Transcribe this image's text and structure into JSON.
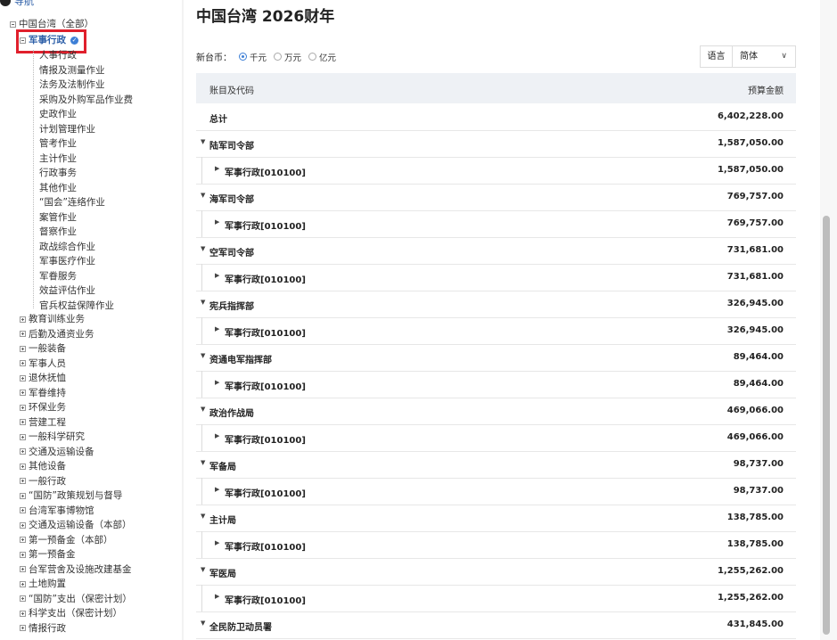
{
  "nav": {
    "title": "导航",
    "root": "中国台湾（全部）",
    "selected": "军事行政",
    "children": [
      "人事行政",
      "情报及测量作业",
      "法务及法制作业",
      "采购及外购军品作业费",
      "史政作业",
      "计划管理作业",
      "管考作业",
      "主计作业",
      "行政事务",
      "其他作业",
      "“国会”连络作业",
      "案管作业",
      "督察作业",
      "政战综合作业",
      "军事医疗作业",
      "军眷服务",
      "效益评估作业",
      "官兵权益保障作业"
    ],
    "siblings": [
      "教育训练业务",
      "后勤及通资业务",
      "一般装备",
      "军事人员",
      "退休抚恤",
      "军眷维持",
      "环保业务",
      "营建工程",
      "一般科学研究",
      "交通及运输设备",
      "其他设备",
      "一般行政",
      "“国防”政策规划与督导",
      "台湾军事博物馆",
      "交通及运输设备（本部）",
      "第一预备金（本部）",
      "第一预备金",
      "台军营舍及设施改建基金",
      "土地购置",
      "“国防”支出（保密计划）",
      "科学支出（保密计划）",
      "情报行政"
    ]
  },
  "page": {
    "title": "中国台湾 2026财年",
    "currency_label": "新台币：",
    "units": [
      {
        "label": "千元",
        "selected": true
      },
      {
        "label": "万元",
        "selected": false
      },
      {
        "label": "亿元",
        "selected": false
      }
    ],
    "language_label": "语言",
    "language_value": "简体"
  },
  "table": {
    "col_name": "账目及代码",
    "col_amount": "预算金额",
    "total_label": "总计",
    "total_amount": "6,402,228.00",
    "groups": [
      {
        "name": "陆军司令部",
        "amount": "1,587,050.00",
        "child": "军事行政[010100]",
        "child_amount": "1,587,050.00"
      },
      {
        "name": "海军司令部",
        "amount": "769,757.00",
        "child": "军事行政[010100]",
        "child_amount": "769,757.00"
      },
      {
        "name": "空军司令部",
        "amount": "731,681.00",
        "child": "军事行政[010100]",
        "child_amount": "731,681.00"
      },
      {
        "name": "宪兵指挥部",
        "amount": "326,945.00",
        "child": "军事行政[010100]",
        "child_amount": "326,945.00"
      },
      {
        "name": "资通电军指挥部",
        "amount": "89,464.00",
        "child": "军事行政[010100]",
        "child_amount": "89,464.00"
      },
      {
        "name": "政治作战局",
        "amount": "469,066.00",
        "child": "军事行政[010100]",
        "child_amount": "469,066.00"
      },
      {
        "name": "军备局",
        "amount": "98,737.00",
        "child": "军事行政[010100]",
        "child_amount": "98,737.00"
      },
      {
        "name": "主计局",
        "amount": "138,785.00",
        "child": "军事行政[010100]",
        "child_amount": "138,785.00"
      },
      {
        "name": "军医局",
        "amount": "1,255,262.00",
        "child": "军事行政[010100]",
        "child_amount": "1,255,262.00"
      },
      {
        "name": "全民防卫动员署",
        "amount": "431,845.00"
      }
    ]
  }
}
